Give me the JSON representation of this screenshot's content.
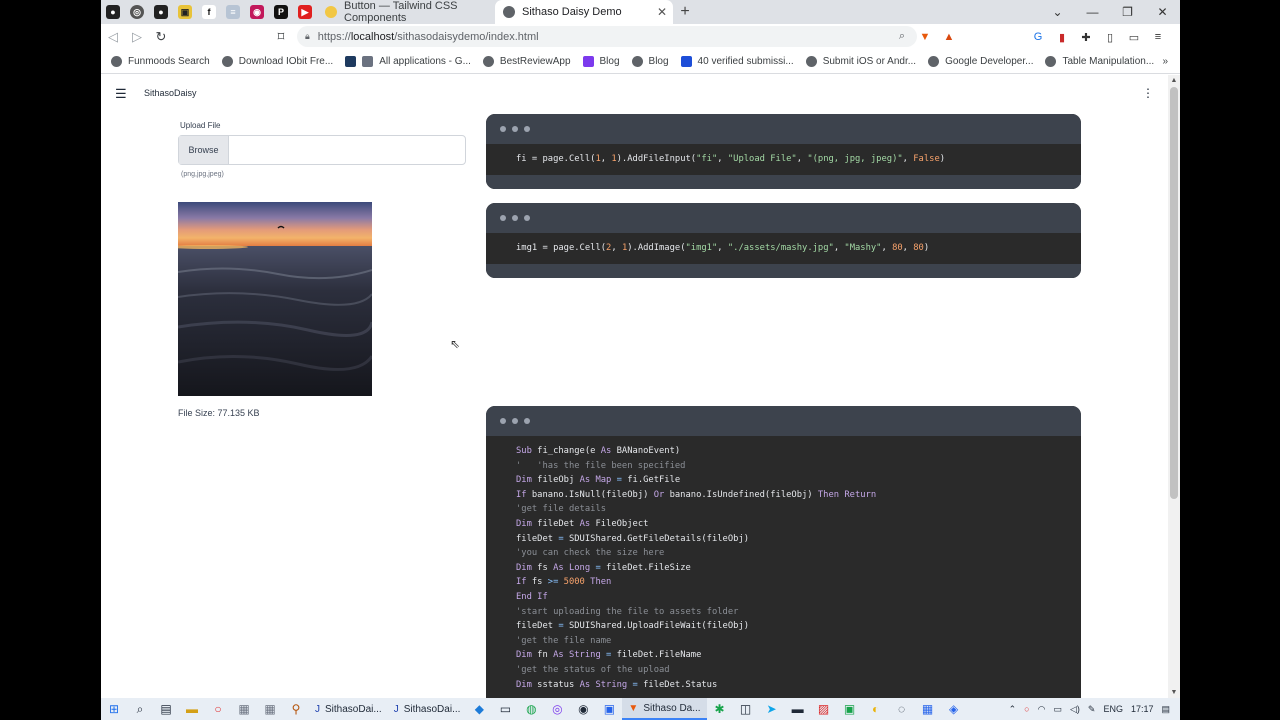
{
  "browser": {
    "tabs": [
      {
        "label": "Button — Tailwind CSS Components",
        "active": false
      },
      {
        "label": "Sithaso Daisy Demo",
        "active": true
      }
    ],
    "pinned_icons": [
      "github-icon",
      "globe-icon",
      "github-icon",
      "yellow-square-icon",
      "facebook-icon",
      "stack-icon",
      "reddit-icon",
      "p-icon",
      "youtube-icon"
    ],
    "url_protocol": "https://",
    "url_host": "localhost",
    "url_path": "/sithasodaisydemo/index.html",
    "bookmarks": [
      "Funmoods Search",
      "Download IObit Fre...",
      "All applications - G...",
      "BestReviewApp",
      "Blog",
      "Blog",
      "40 verified submissi...",
      "Submit iOS or Andr...",
      "Google Developer...",
      "Table Manipulation..."
    ],
    "bookmarks_more": "»"
  },
  "app": {
    "brand": "SithasoDaisy",
    "upload": {
      "label": "Upload File",
      "browse_label": "Browse",
      "value": "",
      "hint": "(png,jpg,jpeg)"
    },
    "file_size_text": "File Size: 77.135 KB"
  },
  "code_blocks": {
    "block1_line": "fi = page.Cell(1, 1).AddFileInput(\"fi\", \"Upload File\", \"(png, jpg, jpeg)\", False)",
    "block2_line": "img1 = page.Cell(2, 1).AddImage(\"img1\", \"./assets/mashy.jpg\", \"Mashy\", 80, 80)",
    "block3_lines": [
      "Sub fi_change(e As BANanoEvent)",
      "'   'has the file been specified",
      "Dim fileObj As Map = fi.GetFile",
      "If banano.IsNull(fileObj) Or banano.IsUndefined(fileObj) Then Return",
      "'get file details",
      "Dim fileDet As FileObject",
      "fileDet = SDUIShared.GetFileDetails(fileObj)",
      "'you can check the size here",
      "Dim fs As Long = fileDet.FileSize",
      "If fs >= 5000 Then",
      "End If",
      "'start uploading the file to assets folder",
      "fileDet = SDUIShared.UploadFileWait(fileObj)",
      "'get the file name",
      "Dim fn As String = fileDet.FileName",
      "'get the status of the upload",
      "Dim sstatus As String = fileDet.Status"
    ]
  },
  "taskbar": {
    "apps": [
      "SithasoDai...",
      "SithasoDai...",
      "Sithaso Da..."
    ],
    "language": "ENG",
    "time": "17:17"
  }
}
